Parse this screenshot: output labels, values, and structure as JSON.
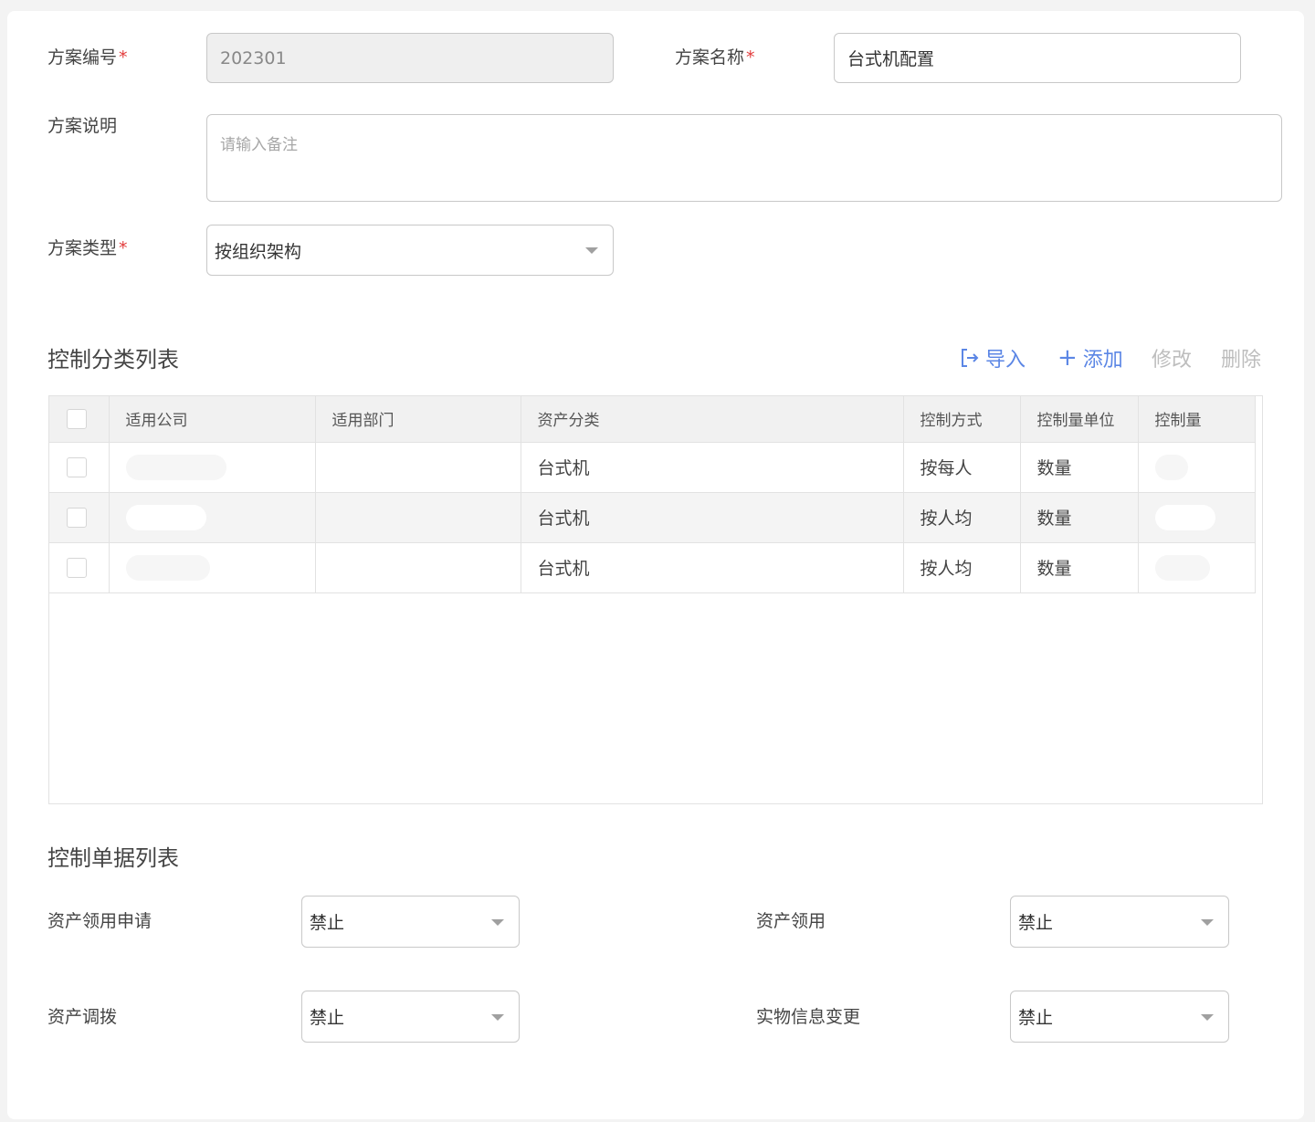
{
  "form": {
    "plan_no": {
      "label": "方案编号",
      "required": "*",
      "value": "202301"
    },
    "plan_name": {
      "label": "方案名称",
      "required": "*",
      "value": "台式机配置"
    },
    "plan_desc": {
      "label": "方案说明",
      "placeholder": "请输入备注"
    },
    "plan_type": {
      "label": "方案类型",
      "required": "*",
      "value": "按组织架构"
    }
  },
  "category_section": {
    "title": "控制分类列表",
    "actions": {
      "import": "导入",
      "add": "添加",
      "edit": "修改",
      "delete": "删除"
    },
    "columns": [
      "适用公司",
      "适用部门",
      "资产分类",
      "控制方式",
      "控制量单位",
      "控制量"
    ],
    "rows": [
      {
        "company": "",
        "department": "",
        "category": "台式机",
        "method": "按每人",
        "unit": "数量",
        "amount": ""
      },
      {
        "company": "",
        "department": "",
        "category": "台式机",
        "method": "按人均",
        "unit": "数量",
        "amount": ""
      },
      {
        "company": "",
        "department": "",
        "category": "台式机",
        "method": "按人均",
        "unit": "数量",
        "amount": ""
      }
    ]
  },
  "document_section": {
    "title": "控制单据列表",
    "fields": [
      {
        "label": "资产领用申请",
        "value": "禁止"
      },
      {
        "label": "资产领用",
        "value": "禁止"
      },
      {
        "label": "资产调拨",
        "value": "禁止"
      },
      {
        "label": "实物信息变更",
        "value": "禁止"
      }
    ]
  },
  "colors": {
    "accent": "#5b86e5",
    "required": "#e23c3c",
    "disabled_text": "#bdbdbd"
  }
}
